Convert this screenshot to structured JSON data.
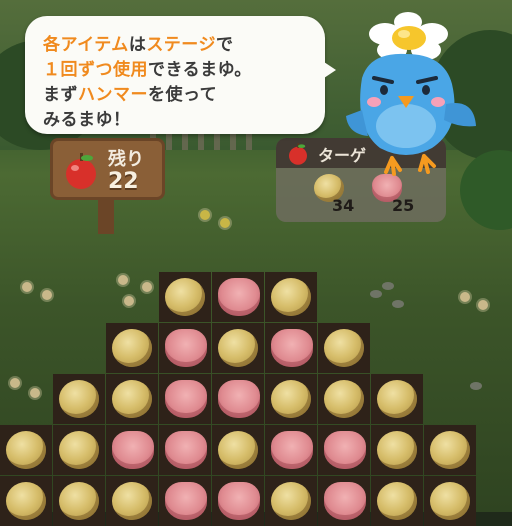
{
  "dialog": {
    "line1": {
      "a": "各アイテム",
      "b": "は",
      "c": "ステージ",
      "d": "で"
    },
    "line2": {
      "a": "１回ずつ使用",
      "b": "できるまゆ。"
    },
    "line3": {
      "a": "まず",
      "b": "ハンマー",
      "c": "を使って"
    },
    "line4": "みるまゆ！"
  },
  "moves": {
    "label": "残り",
    "count": "22",
    "icon": "apple-icon"
  },
  "target": {
    "label": "ターゲ",
    "icon": "apple-icon",
    "items": [
      {
        "icon": "cookie-icon",
        "count": "34"
      },
      {
        "icon": "tulip-icon",
        "count": "25"
      }
    ]
  },
  "board": {
    "rows": [
      [
        "",
        "",
        "",
        "cookie",
        "tulip",
        "cookie",
        "",
        "",
        "",
        ""
      ],
      [
        "",
        "",
        "cookie",
        "tulip",
        "cookie",
        "tulip",
        "cookie",
        "",
        "",
        ""
      ],
      [
        "",
        "cookie",
        "cookie",
        "tulip",
        "tulip",
        "cookie",
        "cookie",
        "cookie",
        "",
        ""
      ],
      [
        "cookie",
        "cookie",
        "tulip",
        "tulip",
        "cookie",
        "tulip",
        "tulip",
        "cookie",
        "cookie",
        ""
      ],
      [
        "cookie",
        "cookie",
        "cookie",
        "tulip",
        "tulip",
        "cookie",
        "tulip",
        "cookie",
        "cookie",
        ""
      ]
    ]
  },
  "colors": {
    "highlight": "#f08a1e",
    "bubble": "#fbfbf7",
    "mascot_body": "#4aa6e6"
  }
}
